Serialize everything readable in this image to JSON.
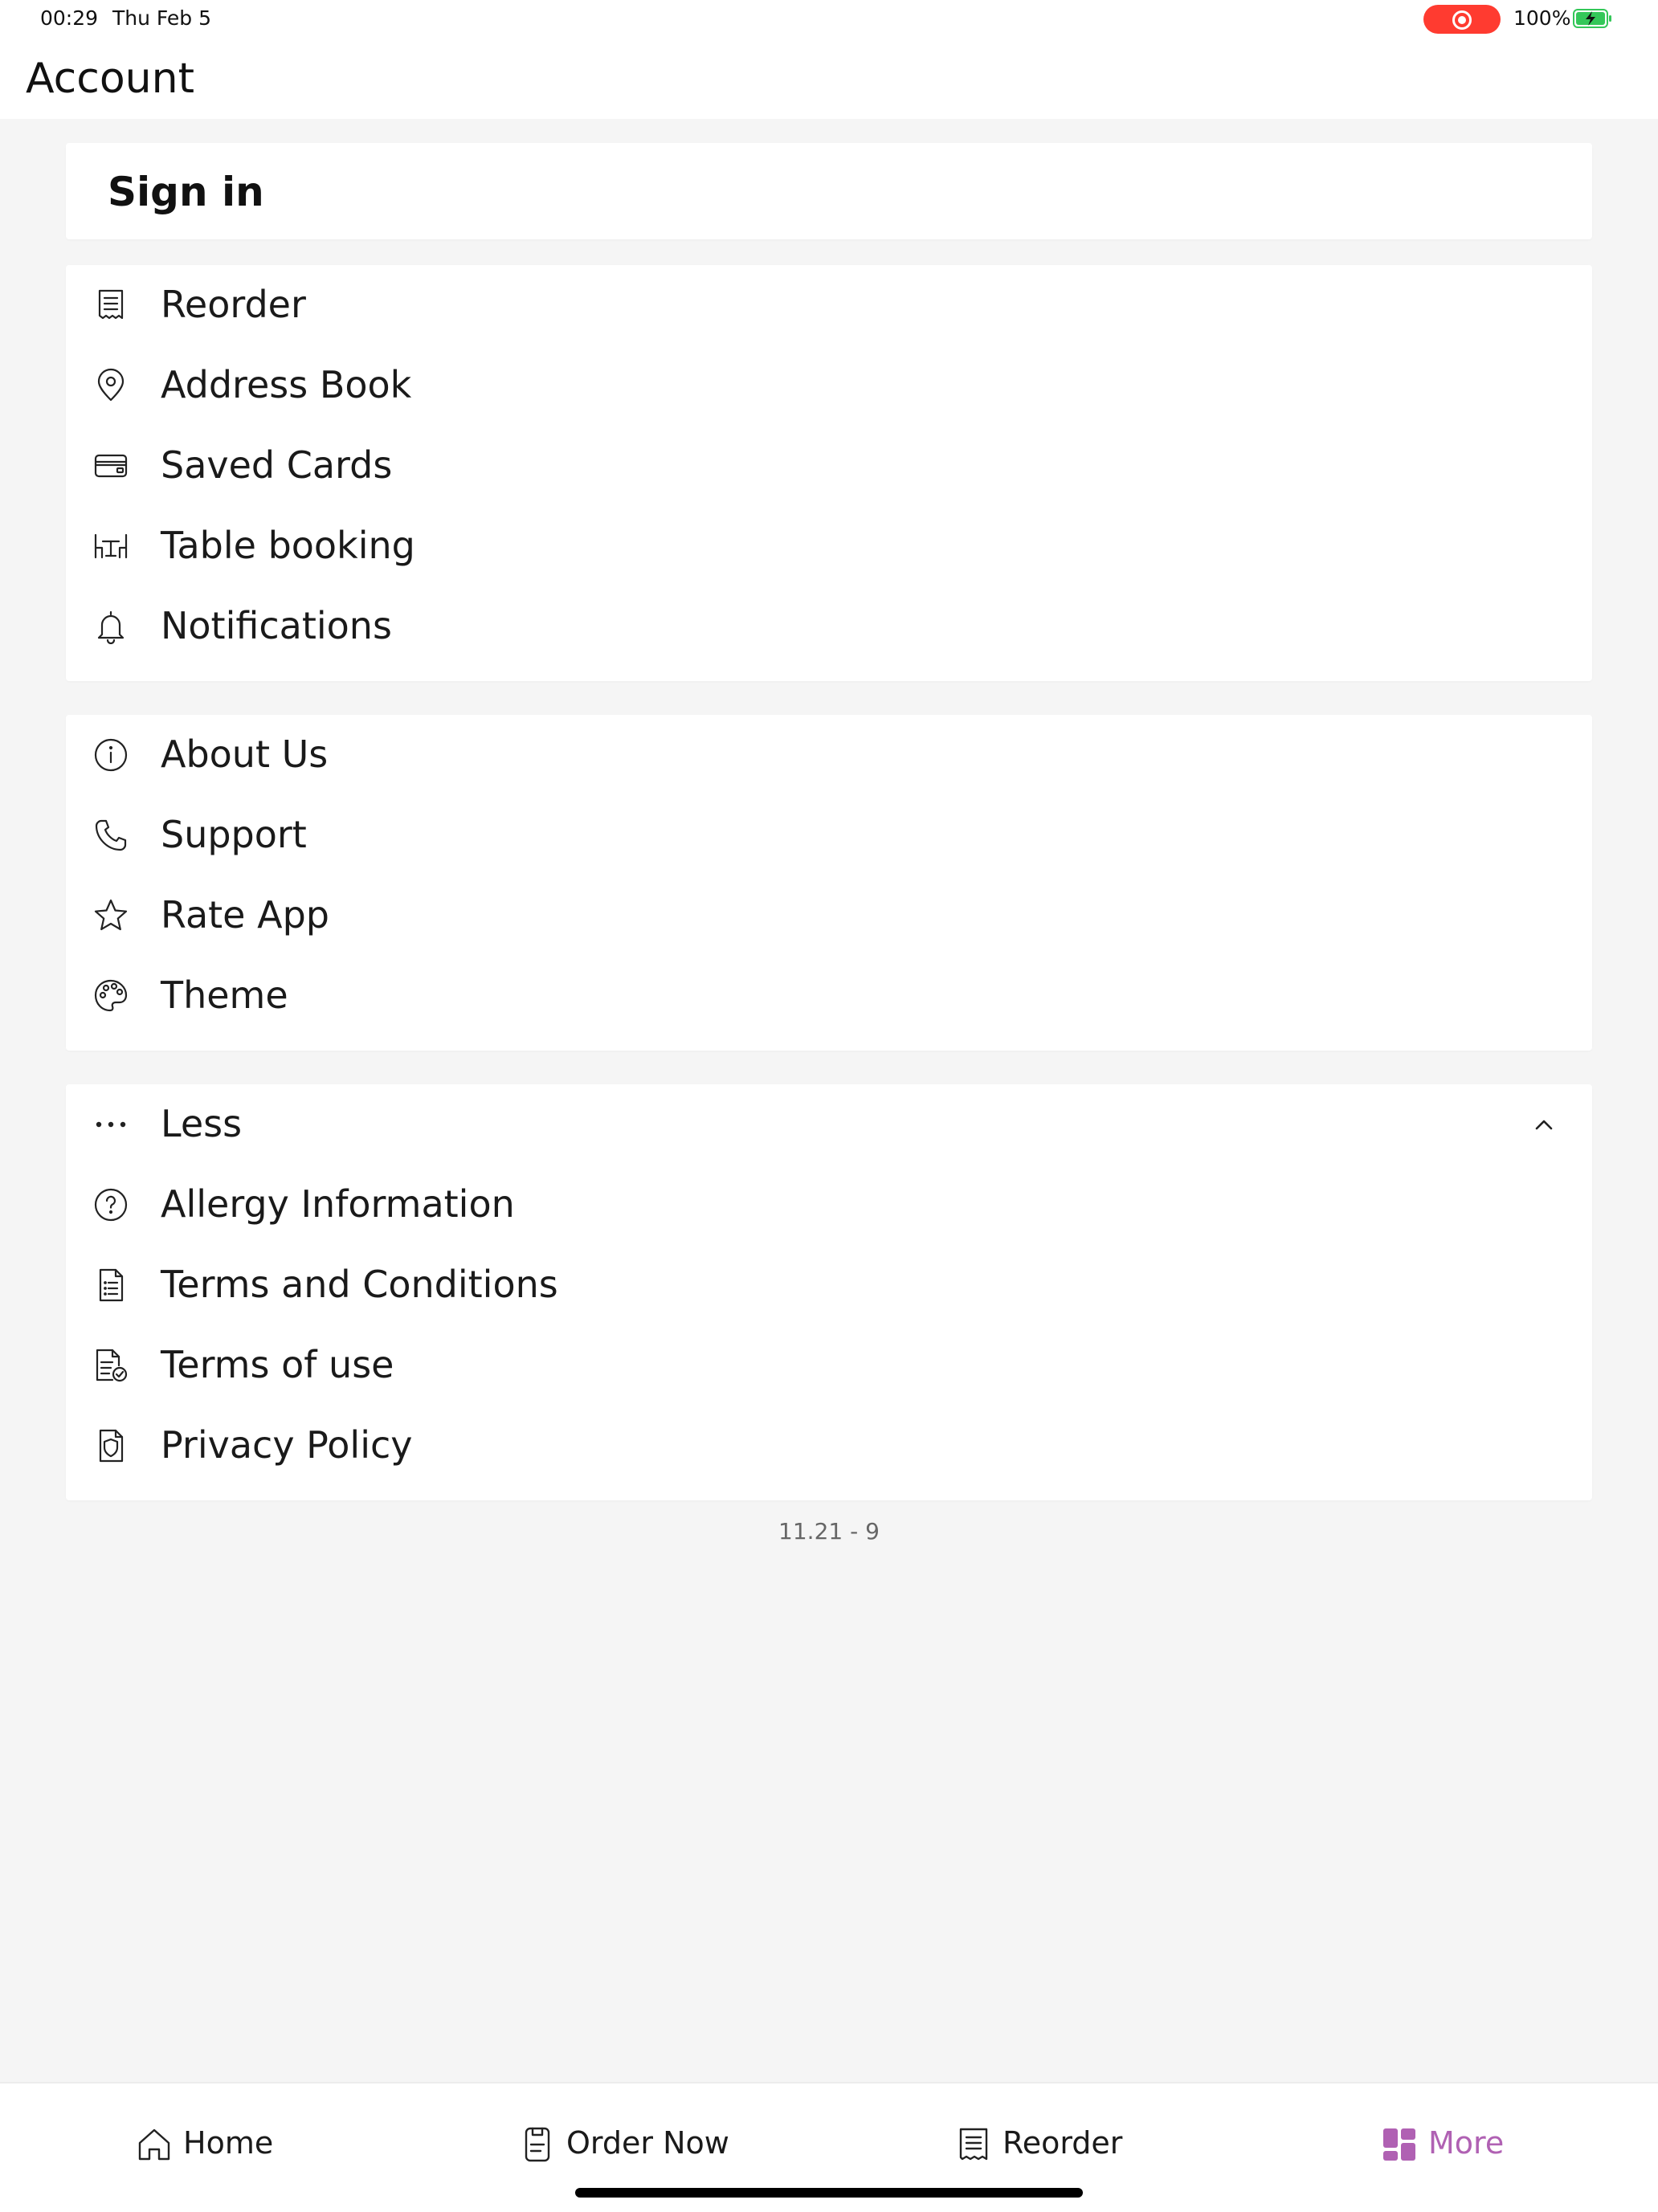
{
  "status_bar": {
    "time": "00:29",
    "date": "Thu Feb 5",
    "battery": "100%"
  },
  "header": {
    "title": "Account"
  },
  "signin": {
    "label": "Sign in"
  },
  "section1": [
    {
      "label": "Reorder",
      "icon": "receipt-icon"
    },
    {
      "label": "Address Book",
      "icon": "location-pin-icon"
    },
    {
      "label": "Saved Cards",
      "icon": "credit-card-icon"
    },
    {
      "label": "Table booking",
      "icon": "table-icon"
    },
    {
      "label": "Notifications",
      "icon": "bell-icon"
    }
  ],
  "section2": [
    {
      "label": "About Us",
      "icon": "info-icon"
    },
    {
      "label": "Support",
      "icon": "phone-icon"
    },
    {
      "label": "Rate App",
      "icon": "star-icon"
    },
    {
      "label": "Theme",
      "icon": "palette-icon"
    }
  ],
  "section3": [
    {
      "label": "Less",
      "icon": "more-dots-icon"
    },
    {
      "label": "Allergy Information",
      "icon": "question-icon"
    },
    {
      "label": "Terms and Conditions",
      "icon": "document-list-icon"
    },
    {
      "label": "Terms of use",
      "icon": "document-check-icon"
    },
    {
      "label": "Privacy Policy",
      "icon": "shield-icon"
    }
  ],
  "version": "11.21 - 9",
  "bottom_nav": [
    {
      "label": "Home",
      "icon": "home-icon"
    },
    {
      "label": "Order Now",
      "icon": "order-icon"
    },
    {
      "label": "Reorder",
      "icon": "receipt-icon"
    },
    {
      "label": "More",
      "icon": "grid-icon",
      "active": true
    }
  ],
  "colors": {
    "accent": "#b061b3",
    "background": "#f5f5f5",
    "card": "#ffffff",
    "record": "#ff3b30",
    "battery": "#34c759"
  }
}
